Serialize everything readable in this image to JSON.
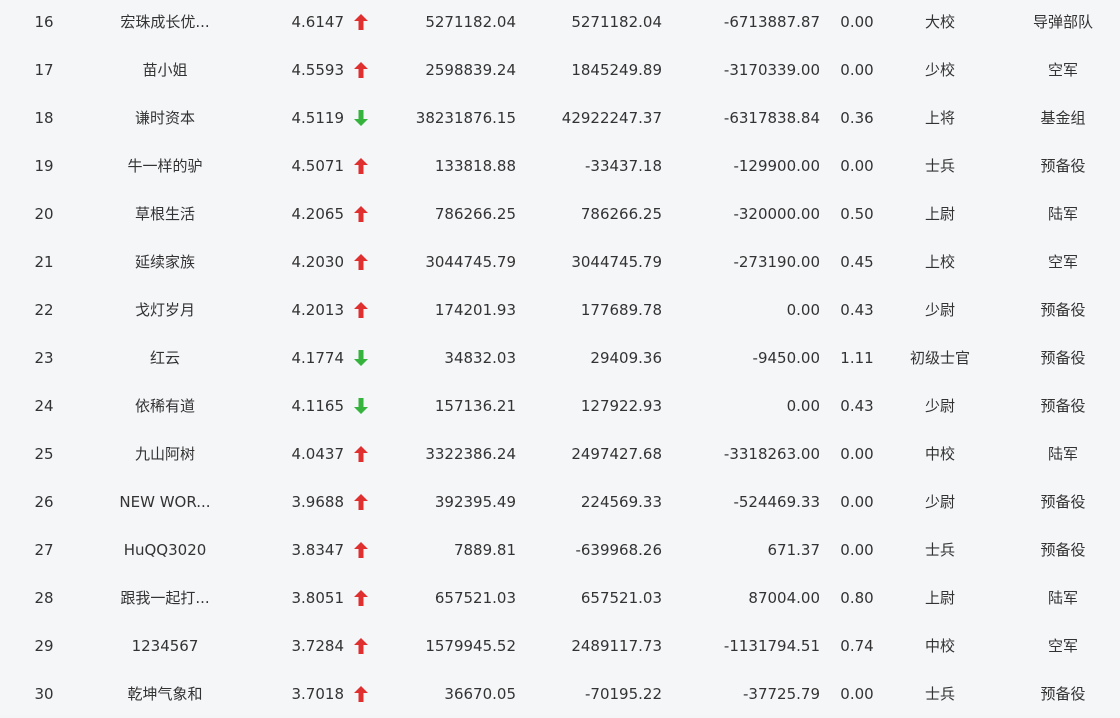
{
  "colors": {
    "up": "#e02f2f",
    "down": "#35b33d",
    "text": "#333333",
    "background": "#f5f6f8"
  },
  "rows": [
    {
      "rank": "16",
      "name": "宏珠成长优...",
      "score": "4.6147",
      "trend": "up",
      "v1": "5271182.04",
      "v2": "5271182.04",
      "v3": "-6713887.87",
      "ratio": "0.00",
      "rank_title": "大校",
      "unit": "导弹部队"
    },
    {
      "rank": "17",
      "name": "苗小姐",
      "score": "4.5593",
      "trend": "up",
      "v1": "2598839.24",
      "v2": "1845249.89",
      "v3": "-3170339.00",
      "ratio": "0.00",
      "rank_title": "少校",
      "unit": "空军"
    },
    {
      "rank": "18",
      "name": "谦时资本",
      "score": "4.5119",
      "trend": "down",
      "v1": "38231876.15",
      "v2": "42922247.37",
      "v3": "-6317838.84",
      "ratio": "0.36",
      "rank_title": "上将",
      "unit": "基金组"
    },
    {
      "rank": "19",
      "name": "牛一样的驴",
      "score": "4.5071",
      "trend": "up",
      "v1": "133818.88",
      "v2": "-33437.18",
      "v3": "-129900.00",
      "ratio": "0.00",
      "rank_title": "士兵",
      "unit": "预备役"
    },
    {
      "rank": "20",
      "name": "草根生活",
      "score": "4.2065",
      "trend": "up",
      "v1": "786266.25",
      "v2": "786266.25",
      "v3": "-320000.00",
      "ratio": "0.50",
      "rank_title": "上尉",
      "unit": "陆军"
    },
    {
      "rank": "21",
      "name": "延续家族",
      "score": "4.2030",
      "trend": "up",
      "v1": "3044745.79",
      "v2": "3044745.79",
      "v3": "-273190.00",
      "ratio": "0.45",
      "rank_title": "上校",
      "unit": "空军"
    },
    {
      "rank": "22",
      "name": "戈灯岁月",
      "score": "4.2013",
      "trend": "up",
      "v1": "174201.93",
      "v2": "177689.78",
      "v3": "0.00",
      "ratio": "0.43",
      "rank_title": "少尉",
      "unit": "预备役"
    },
    {
      "rank": "23",
      "name": "红云",
      "score": "4.1774",
      "trend": "down",
      "v1": "34832.03",
      "v2": "29409.36",
      "v3": "-9450.00",
      "ratio": "1.11",
      "rank_title": "初级士官",
      "unit": "预备役"
    },
    {
      "rank": "24",
      "name": "依稀有道",
      "score": "4.1165",
      "trend": "down",
      "v1": "157136.21",
      "v2": "127922.93",
      "v3": "0.00",
      "ratio": "0.43",
      "rank_title": "少尉",
      "unit": "预备役"
    },
    {
      "rank": "25",
      "name": "九山阿树",
      "score": "4.0437",
      "trend": "up",
      "v1": "3322386.24",
      "v2": "2497427.68",
      "v3": "-3318263.00",
      "ratio": "0.00",
      "rank_title": "中校",
      "unit": "陆军"
    },
    {
      "rank": "26",
      "name": "NEW WOR...",
      "score": "3.9688",
      "trend": "up",
      "v1": "392395.49",
      "v2": "224569.33",
      "v3": "-524469.33",
      "ratio": "0.00",
      "rank_title": "少尉",
      "unit": "预备役"
    },
    {
      "rank": "27",
      "name": "HuQQ3020",
      "score": "3.8347",
      "trend": "up",
      "v1": "7889.81",
      "v2": "-639968.26",
      "v3": "671.37",
      "ratio": "0.00",
      "rank_title": "士兵",
      "unit": "预备役"
    },
    {
      "rank": "28",
      "name": "跟我一起打...",
      "score": "3.8051",
      "trend": "up",
      "v1": "657521.03",
      "v2": "657521.03",
      "v3": "87004.00",
      "ratio": "0.80",
      "rank_title": "上尉",
      "unit": "陆军"
    },
    {
      "rank": "29",
      "name": "1234567",
      "score": "3.7284",
      "trend": "up",
      "v1": "1579945.52",
      "v2": "2489117.73",
      "v3": "-1131794.51",
      "ratio": "0.74",
      "rank_title": "中校",
      "unit": "空军"
    },
    {
      "rank": "30",
      "name": "乾坤气象和",
      "score": "3.7018",
      "trend": "up",
      "v1": "36670.05",
      "v2": "-70195.22",
      "v3": "-37725.79",
      "ratio": "0.00",
      "rank_title": "士兵",
      "unit": "预备役"
    }
  ]
}
